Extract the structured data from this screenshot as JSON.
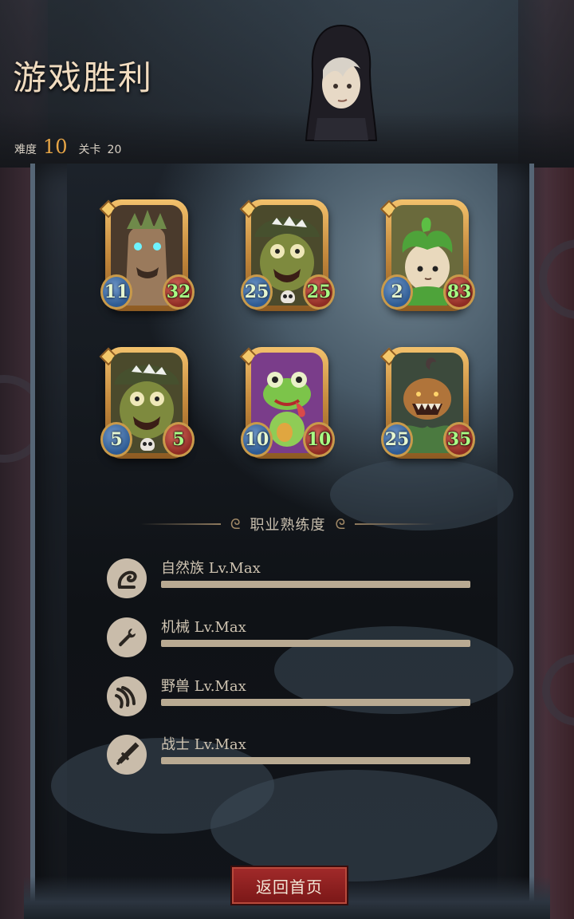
{
  "header": {
    "title": "游戏胜利",
    "difficulty_label": "难度",
    "difficulty_value": "10",
    "stage_label": "关卡",
    "stage_value": "20"
  },
  "cards": [
    {
      "name": "treant",
      "attack": "11",
      "health": "32",
      "has_skull": false
    },
    {
      "name": "mushroom-monster",
      "attack": "25",
      "health": "25",
      "has_skull": true
    },
    {
      "name": "sprout-child",
      "attack": "2",
      "health": "83",
      "has_skull": false
    },
    {
      "name": "mushroom-monster",
      "attack": "5",
      "health": "5",
      "has_skull": true
    },
    {
      "name": "frog",
      "attack": "10",
      "health": "10",
      "has_skull": false
    },
    {
      "name": "pumpkin-monster",
      "attack": "25",
      "health": "35",
      "has_skull": false
    }
  ],
  "mastery": {
    "title": "职业熟练度",
    "items": [
      {
        "label": "自然族 Lv.Max",
        "icon": "nature-icon",
        "progress": 1.0
      },
      {
        "label": "机械 Lv.Max",
        "icon": "wrench-icon",
        "progress": 1.0
      },
      {
        "label": "野兽 Lv.Max",
        "icon": "claw-icon",
        "progress": 1.0
      },
      {
        "label": "战士 Lv.Max",
        "icon": "sword-icon",
        "progress": 1.0
      }
    ]
  },
  "footer": {
    "back_label": "返回首页"
  },
  "colors": {
    "accent": "#e8a646",
    "attack_gem": "#2e5b93",
    "health_gem": "#8f2c24",
    "button": "#8f1f1f"
  }
}
